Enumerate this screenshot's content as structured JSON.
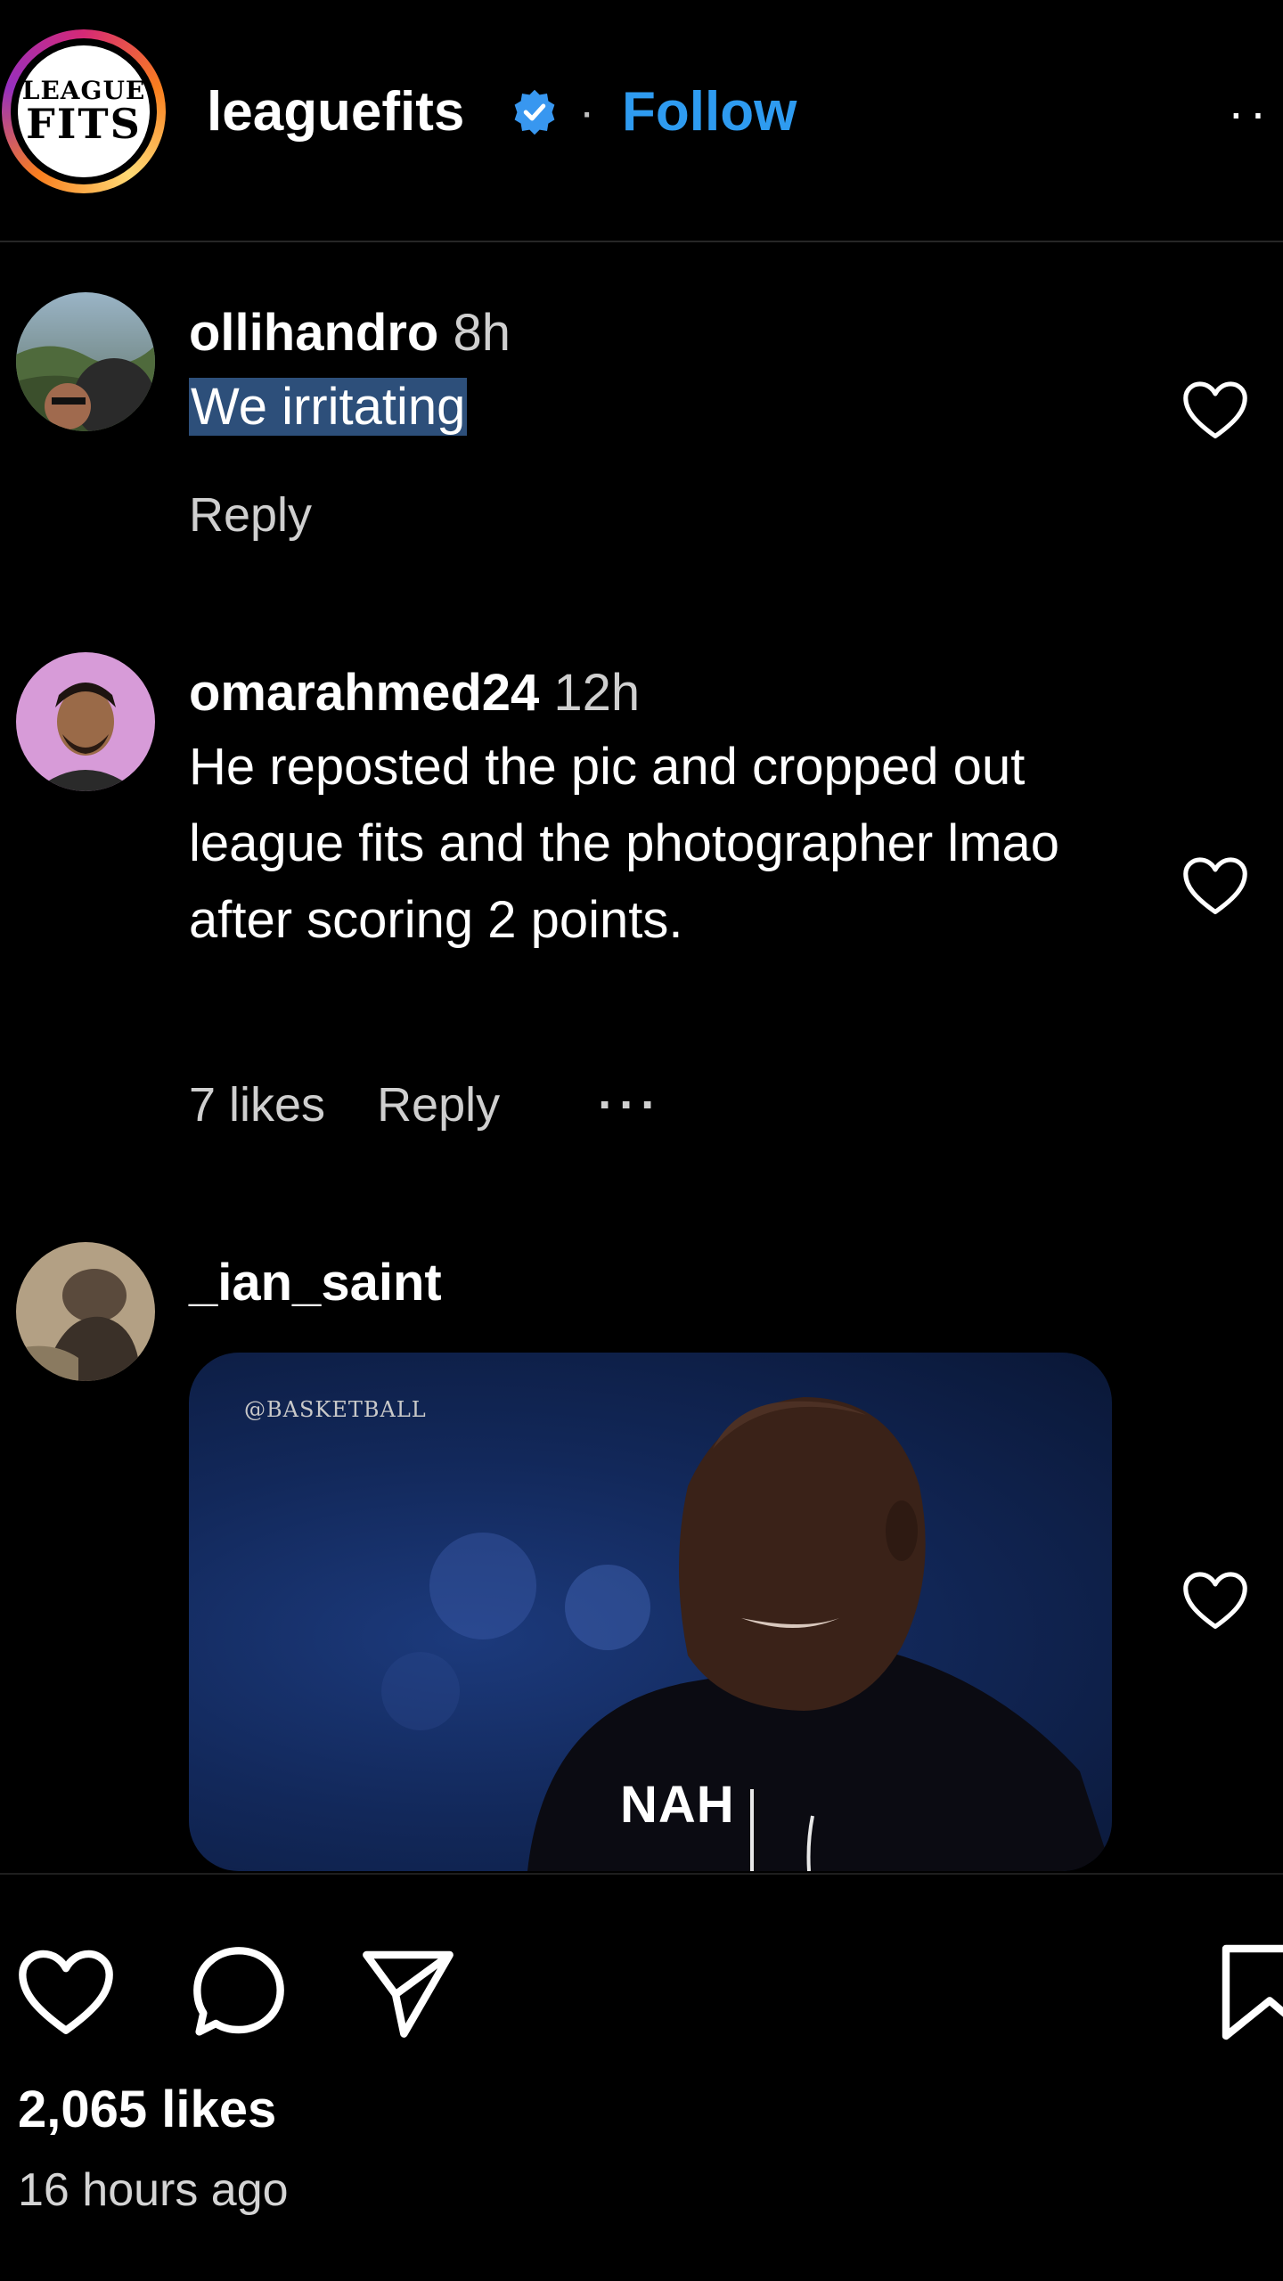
{
  "header": {
    "avatar_logo_line1": "LEAGUE",
    "avatar_logo_line2": "FITS",
    "username": "leaguefits",
    "separator": "·",
    "follow_label": "Follow",
    "more_icon": "more-horizontal-icon"
  },
  "comments": [
    {
      "username": "ollihandro",
      "time": "8h",
      "text": "We irritating",
      "reply_label": "Reply"
    },
    {
      "username": "omarahmed24",
      "time": "12h",
      "text": "He reposted the pic and cropped out league fits and the photographer lmao after scoring 2 points.",
      "likes": "7 likes",
      "reply_label": "Reply",
      "more": "···"
    },
    {
      "username": "_ian_saint",
      "gif_watermark": "@BASKETBALL",
      "gif_caption": "NAH"
    }
  ],
  "actions": {
    "like_icon": "heart-icon",
    "comment_icon": "comment-icon",
    "share_icon": "send-icon",
    "save_icon": "bookmark-icon"
  },
  "post": {
    "likes": "2,065 likes",
    "time_ago": "16 hours ago"
  },
  "colors": {
    "background": "#000000",
    "follow_blue": "#2e9bf0",
    "verified_blue": "#3897f0",
    "highlight": "#2d4f7a"
  }
}
